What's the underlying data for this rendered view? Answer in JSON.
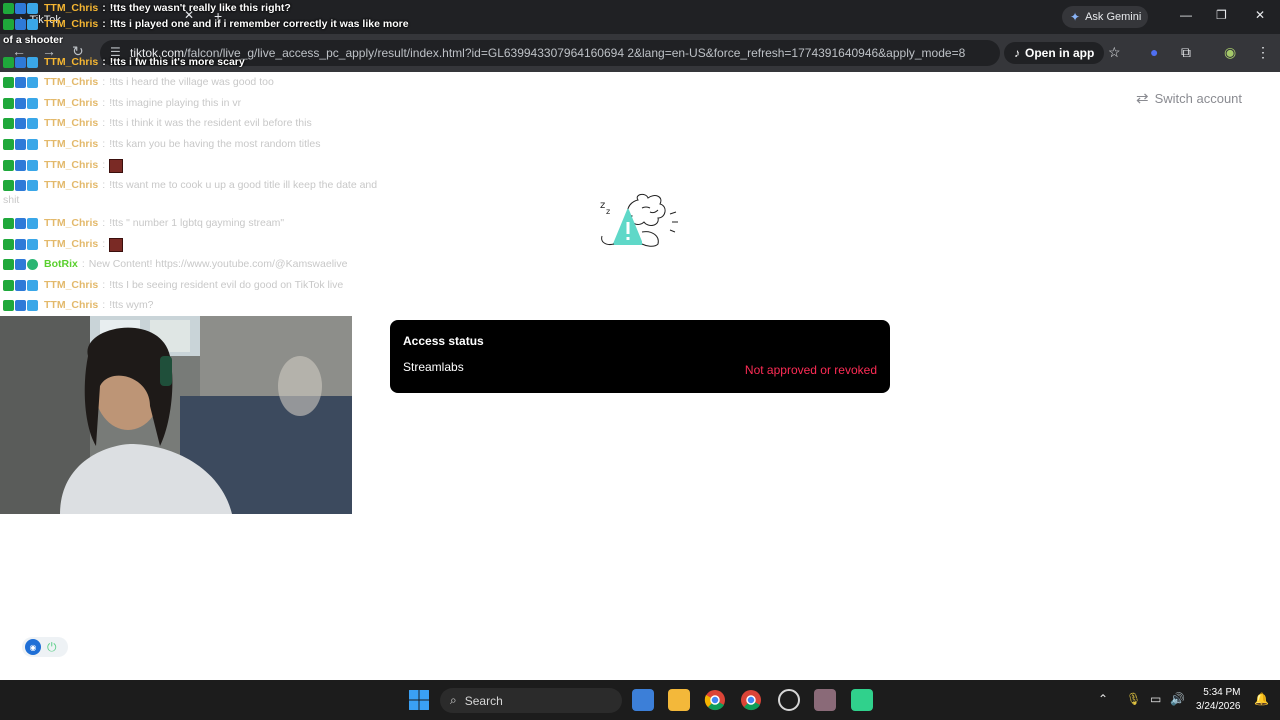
{
  "browser": {
    "tab_title": "TikTok",
    "url_domain": "tiktok.com",
    "url_path": "/falcon/live_g/live_access_pc_apply/result/index.html?id=GL639943307964160694 2&lang=en-US&force_refresh=1774391640946&apply_mode=8",
    "ask_gemini": "Ask Gemini",
    "open_in_app": "Open in app"
  },
  "page": {
    "switch_account": "Switch account",
    "access_card": {
      "title": "Access status",
      "app_name": "Streamlabs",
      "status": "Not approved or revoked"
    }
  },
  "chat": [
    {
      "user": "TTM_Chris",
      "msg": "!tts they wasn't really like this right?",
      "style": "strong"
    },
    {
      "user": "TTM_Chris",
      "msg": "!tts i played one and if i remember correctly it was like more",
      "style": "strong"
    },
    {
      "wrap": "of a shooter",
      "style": "strong"
    },
    {
      "user": "TTM_Chris",
      "msg": "!tts i fw this it's more scary",
      "style": "strong"
    },
    {
      "user": "TTM_Chris",
      "msg": "!tts i heard the village was good too",
      "style": "faded"
    },
    {
      "user": "TTM_Chris",
      "msg": "!tts imagine playing this in vr",
      "style": "faded"
    },
    {
      "user": "TTM_Chris",
      "msg": "!tts i think it was the resident evil before this",
      "style": "faded"
    },
    {
      "user": "TTM_Chris",
      "msg": "!tts kam you be having the most random titles",
      "style": "faded"
    },
    {
      "user": "TTM_Chris",
      "msg": "",
      "emote": true,
      "style": "faded"
    },
    {
      "user": "TTM_Chris",
      "msg": "!tts want me to cook u up a good title ill keep the date and",
      "style": "faded"
    },
    {
      "wrap": "shit",
      "style": "faded"
    },
    {
      "user": "TTM_Chris",
      "msg": "!tts \" number 1 lgbtq gayming stream\"",
      "style": "faded"
    },
    {
      "user": "TTM_Chris",
      "msg": "",
      "emote": true,
      "style": "faded"
    },
    {
      "user": "BotRix",
      "msg": "New Content! https://www.youtube.com/@Kamswaelive",
      "style": "faded",
      "bot": true
    },
    {
      "user": "TTM_Chris",
      "msg": "!tts I be seeing resident evil do good on TikTok live",
      "style": "faded"
    },
    {
      "user": "TTM_Chris",
      "msg": "!tts wym?",
      "style": "faded"
    }
  ],
  "taskbar": {
    "search": "Search",
    "time": "5:34 PM",
    "date": "3/24/2026"
  },
  "colors": {
    "status_red": "#fe2c55",
    "card_bg": "#000000",
    "chat_user": "#f2a62b",
    "bot_user": "#5ad02e"
  }
}
